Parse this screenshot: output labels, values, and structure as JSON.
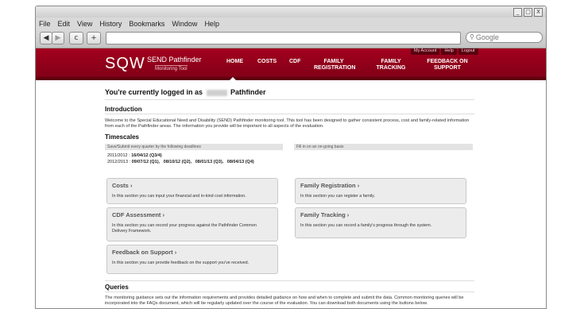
{
  "menu": [
    "File",
    "Edit",
    "View",
    "History",
    "Bookmarks",
    "Window",
    "Help"
  ],
  "window_buttons": [
    "_",
    "□",
    "X"
  ],
  "toolbar": {
    "back": "◀",
    "forward": "▶",
    "reload": "c",
    "add": "+",
    "search_placeholder": "Google"
  },
  "site": {
    "logo": "SQW",
    "logo_title": "SEND Pathfinder",
    "logo_subtitle": "Monitoring Tool",
    "util_links": [
      "My Account",
      "Help",
      "Logout"
    ],
    "nav": [
      "HOME",
      "COSTS",
      "CDF",
      "FAMILY REGISTRATION",
      "FAMILY TRACKING",
      "FEEDBACK ON SUPPORT"
    ]
  },
  "welcome": {
    "prefix": "You're currently logged in as",
    "suffix": "Pathfinder"
  },
  "intro": {
    "heading": "Introduction",
    "text": "Welcome to the Special Educational Need and Disability (SEND) Pathfinder monitoring tool. This tool has been designed to gather consistent process, cost and family-related information from each of the Pathfinder areas. The information you provide will be important to all aspects of the evaluation."
  },
  "timescales": {
    "heading": "Timescales",
    "left_header": "Save/Submit every quarter by the following deadlines",
    "right_header": "Fill in on an on-going basis",
    "row1_label": "2011/2012 :",
    "row1_date": "16/04/12 (Q3/4)",
    "row2_label": "2012/2013 :",
    "row2_dates": [
      "09/07/12 (Q1),",
      "08/10/12 (Q2),",
      "08/01/13 (Q3),",
      "08/04/13 (Q4)"
    ]
  },
  "cards": {
    "costs": {
      "title": "Costs",
      "desc": "In this section you can input your financial and in-kind cost information."
    },
    "family_registration": {
      "title": "Family Registration",
      "desc": "In this section you can register a family."
    },
    "cdf": {
      "title": "CDF Assessment",
      "desc": "In this section you can record your progress against the Pathfinder Common Delivery Framework."
    },
    "family_tracking": {
      "title": "Family Tracking",
      "desc": "In this section you can record a family's progress through the system."
    },
    "feedback": {
      "title": "Feedback on Support",
      "desc": "In this section you can provide feedback on the support you've received."
    }
  },
  "queries": {
    "heading": "Queries",
    "text": "The monitoring guidance sets out the information requirements and provides detailed guidance on how and when to complete and submit the data. Common monitoring queries will be incorporated into the FAQs document, which will be regularly updated over the course of the evaluation. You can download both documents using the buttons below."
  },
  "colors": {
    "brand": "#8e001a",
    "card_bg": "#ececec"
  }
}
